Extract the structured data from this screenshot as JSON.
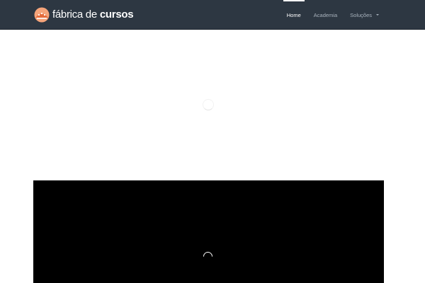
{
  "brand": {
    "name_light": "fábrica de",
    "name_bold": "cursos",
    "logo_icon": "abacus-dome-icon",
    "logo_colors": [
      "#f5a47a",
      "#e56b3b",
      "#ffffff"
    ]
  },
  "nav": {
    "items": [
      {
        "label": "Home",
        "active": true
      },
      {
        "label": "Academia",
        "active": false
      },
      {
        "label": "Soluções",
        "active": false,
        "has_dropdown": true
      }
    ]
  },
  "colors": {
    "header_bg": "#2d3742",
    "nav_text": "#a9b3bd",
    "nav_active": "#ffffff",
    "video_bg": "#000000"
  },
  "icons": {
    "content_loader": "spinner-icon",
    "video_loader": "spinner-icon"
  }
}
